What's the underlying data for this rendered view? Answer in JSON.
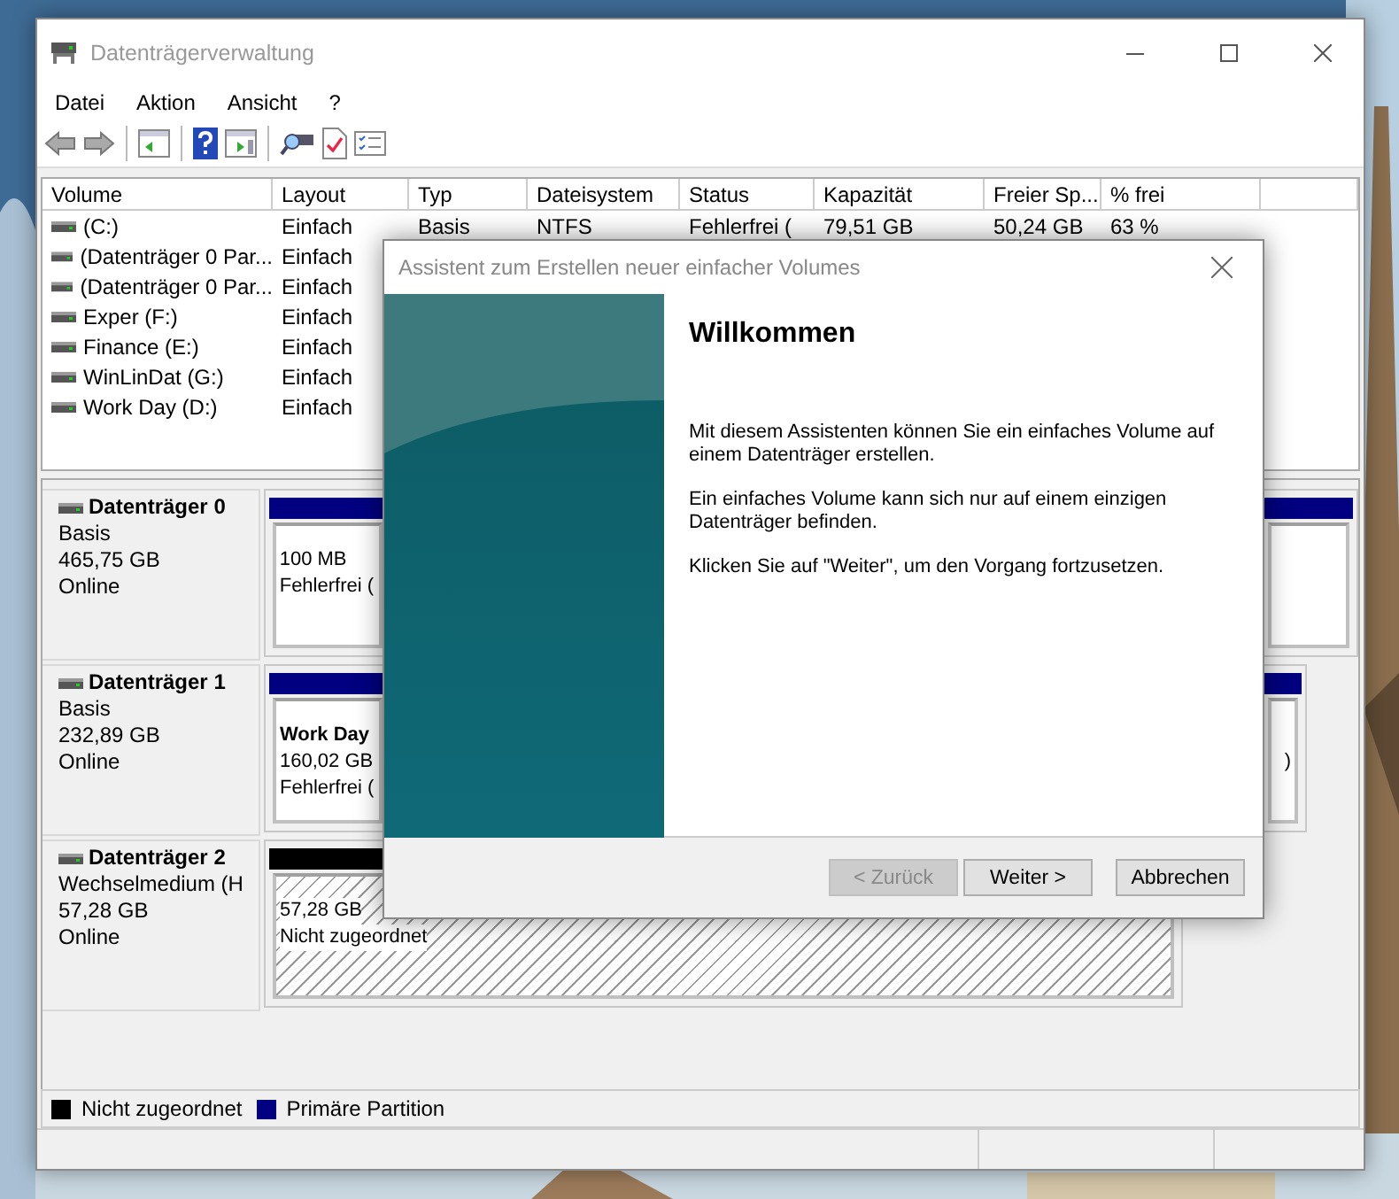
{
  "window": {
    "title": "Datenträgerverwaltung"
  },
  "menu": [
    "Datei",
    "Aktion",
    "Ansicht",
    "?"
  ],
  "volume_table": {
    "columns": [
      "Volume",
      "Layout",
      "Typ",
      "Dateisystem",
      "Status",
      "Kapazität",
      "Freier Sp...",
      "% frei"
    ],
    "rows": [
      {
        "cells": [
          "(C:)",
          "Einfach",
          "Basis",
          "NTFS",
          "Fehlerfrei (",
          "79,51 GB",
          "50,24 GB",
          "63 %"
        ]
      },
      {
        "cells": [
          "(Datenträger 0 Par...",
          "Einfach"
        ]
      },
      {
        "cells": [
          "(Datenträger 0 Par...",
          "Einfach"
        ]
      },
      {
        "cells": [
          "Exper (F:)",
          "Einfach"
        ]
      },
      {
        "cells": [
          "Finance (E:)",
          "Einfach"
        ]
      },
      {
        "cells": [
          "WinLinDat (G:)",
          "Einfach"
        ]
      },
      {
        "cells": [
          "Work Day (D:)",
          "Einfach"
        ]
      }
    ]
  },
  "disks": [
    {
      "name": "Datenträger 0",
      "type": "Basis",
      "size": "465,75 GB",
      "status": "Online",
      "partitions": [
        {
          "kind": "primary",
          "lines": [
            "100 MB",
            "Fehlerfrei ("
          ]
        },
        {
          "kind": "primary"
        }
      ]
    },
    {
      "name": "Datenträger 1",
      "type": "Basis",
      "size": "232,89 GB",
      "status": "Online",
      "partitions": [
        {
          "kind": "primary",
          "title": "Work Day",
          "lines": [
            "160,02 GB",
            "Fehlerfrei ("
          ]
        },
        {
          "kind": "primary",
          "lines": [
            ")"
          ]
        }
      ]
    },
    {
      "name": "Datenträger 2",
      "type": "Wechselmedium (H",
      "size": "57,28 GB",
      "status": "Online",
      "partitions": [
        {
          "kind": "unallocated",
          "lines": [
            "57,28 GB",
            "Nicht zugeordnet"
          ]
        }
      ]
    }
  ],
  "legend": [
    {
      "label": "Nicht zugeordnet",
      "color": "#000000"
    },
    {
      "label": "Primäre Partition",
      "color": "#000080"
    }
  ],
  "wizard": {
    "title": "Assistent zum Erstellen neuer einfacher Volumes",
    "heading": "Willkommen",
    "paragraphs": [
      "Mit diesem Assistenten können Sie ein einfaches Volume auf einem Datenträger erstellen.",
      "Ein einfaches Volume kann sich nur auf einem einzigen Datenträger befinden.",
      "Klicken Sie auf \"Weiter\", um den Vorgang fortzusetzen."
    ],
    "buttons": [
      {
        "label": "< Zurück",
        "disabled": true
      },
      {
        "label": "Weiter >",
        "disabled": false
      },
      {
        "label": "Abbrechen",
        "disabled": false
      }
    ]
  }
}
